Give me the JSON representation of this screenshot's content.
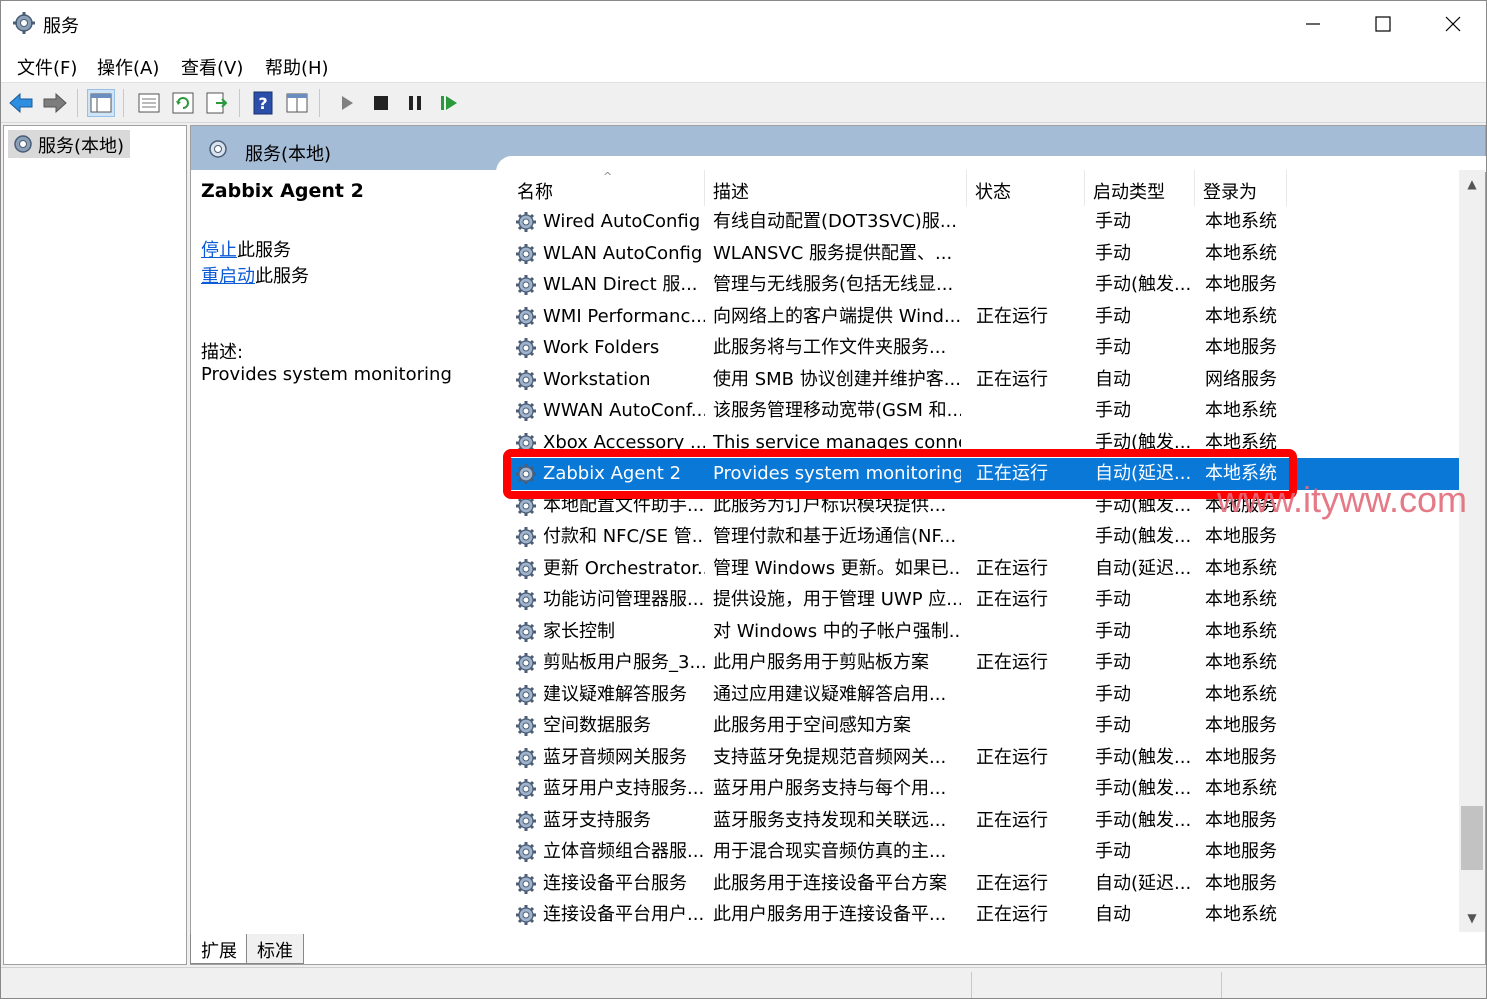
{
  "window": {
    "title": "服务",
    "controls": {
      "minimize": "minimize",
      "maximize": "maximize",
      "close": "close"
    }
  },
  "menu": [
    "文件(F)",
    "操作(A)",
    "查看(V)",
    "帮助(H)"
  ],
  "toolbar": [
    "back-icon",
    "forward-icon",
    "show-tree-icon",
    "properties-icon",
    "refresh-icon",
    "export-icon",
    "help-icon",
    "console-icon",
    "play-icon",
    "stop-icon",
    "pause-icon",
    "resume-icon"
  ],
  "tree": {
    "node": "服务(本地)"
  },
  "main": {
    "header": "服务(本地)",
    "detail": {
      "name": "Zabbix Agent 2",
      "stop_link": "停止",
      "stop_suffix": "此服务",
      "restart_link": "重启动",
      "restart_suffix": "此服务",
      "desc_label": "描述:",
      "desc": "Provides system monitoring"
    },
    "columns": [
      "名称",
      "描述",
      "状态",
      "启动类型",
      "登录为"
    ],
    "rows": [
      {
        "name": "Wired AutoConfig",
        "desc": "有线自动配置(DOT3SVC)服...",
        "status": "",
        "type": "手动",
        "logon": "本地系统"
      },
      {
        "name": "WLAN AutoConfig",
        "desc": "WLANSVC 服务提供配置、...",
        "status": "",
        "type": "手动",
        "logon": "本地系统"
      },
      {
        "name": "WLAN Direct 服...",
        "desc": "管理与无线服务(包括无线显...",
        "status": "",
        "type": "手动(触发...",
        "logon": "本地服务"
      },
      {
        "name": "WMI Performanc...",
        "desc": "向网络上的客户端提供 Wind...",
        "status": "正在运行",
        "type": "手动",
        "logon": "本地系统"
      },
      {
        "name": "Work Folders",
        "desc": "此服务将与工作文件夹服务...",
        "status": "",
        "type": "手动",
        "logon": "本地服务"
      },
      {
        "name": "Workstation",
        "desc": "使用 SMB 协议创建并维护客...",
        "status": "正在运行",
        "type": "自动",
        "logon": "网络服务"
      },
      {
        "name": "WWAN AutoConf...",
        "desc": "该服务管理移动宽带(GSM 和...",
        "status": "",
        "type": "手动",
        "logon": "本地系统"
      },
      {
        "name": "Xbox Accessory ...",
        "desc": "This service manages conne...",
        "status": "",
        "type": "手动(触发...",
        "logon": "本地系统"
      },
      {
        "name": "Zabbix Agent 2",
        "desc": "Provides system monitoring",
        "status": "正在运行",
        "type": "自动(延迟...",
        "logon": "本地系统",
        "selected": true
      },
      {
        "name": "本地配置文件助手...",
        "desc": "此服务为订户标识模块提供...",
        "status": "",
        "type": "手动(触发...",
        "logon": "本地服务"
      },
      {
        "name": "付款和 NFC/SE 管...",
        "desc": "管理付款和基于近场通信(NF...",
        "status": "",
        "type": "手动(触发...",
        "logon": "本地服务"
      },
      {
        "name": "更新 Orchestrator...",
        "desc": "管理 Windows 更新。如果已...",
        "status": "正在运行",
        "type": "自动(延迟...",
        "logon": "本地系统"
      },
      {
        "name": "功能访问管理器服...",
        "desc": "提供设施，用于管理 UWP 应...",
        "status": "正在运行",
        "type": "手动",
        "logon": "本地系统"
      },
      {
        "name": "家长控制",
        "desc": "对 Windows 中的子帐户强制...",
        "status": "",
        "type": "手动",
        "logon": "本地系统"
      },
      {
        "name": "剪贴板用户服务_3...",
        "desc": "此用户服务用于剪贴板方案",
        "status": "正在运行",
        "type": "手动",
        "logon": "本地系统"
      },
      {
        "name": "建议疑难解答服务",
        "desc": "通过应用建议疑难解答启用...",
        "status": "",
        "type": "手动",
        "logon": "本地系统"
      },
      {
        "name": "空间数据服务",
        "desc": "此服务用于空间感知方案",
        "status": "",
        "type": "手动",
        "logon": "本地服务"
      },
      {
        "name": "蓝牙音频网关服务",
        "desc": "支持蓝牙免提规范音频网关...",
        "status": "正在运行",
        "type": "手动(触发...",
        "logon": "本地服务"
      },
      {
        "name": "蓝牙用户支持服务...",
        "desc": "蓝牙用户服务支持与每个用...",
        "status": "",
        "type": "手动(触发...",
        "logon": "本地系统"
      },
      {
        "name": "蓝牙支持服务",
        "desc": "蓝牙服务支持发现和关联远...",
        "status": "正在运行",
        "type": "手动(触发...",
        "logon": "本地服务"
      },
      {
        "name": "立体音频组合器服...",
        "desc": "用于混合现实音频仿真的主...",
        "status": "",
        "type": "手动",
        "logon": "本地服务"
      },
      {
        "name": "连接设备平台服务",
        "desc": "此服务用于连接设备平台方案",
        "status": "正在运行",
        "type": "自动(延迟...",
        "logon": "本地服务"
      },
      {
        "name": "连接设备平台用户...",
        "desc": "此用户服务用于连接设备平...",
        "status": "正在运行",
        "type": "自动",
        "logon": "本地系统"
      }
    ]
  },
  "tabs": [
    "扩展",
    "标准"
  ],
  "watermark": "www.ityww.com",
  "colors": {
    "selection": "#0a78d7",
    "header": "#a5bcd6",
    "highlight": "#ff0000",
    "link": "#0b5ad8"
  }
}
